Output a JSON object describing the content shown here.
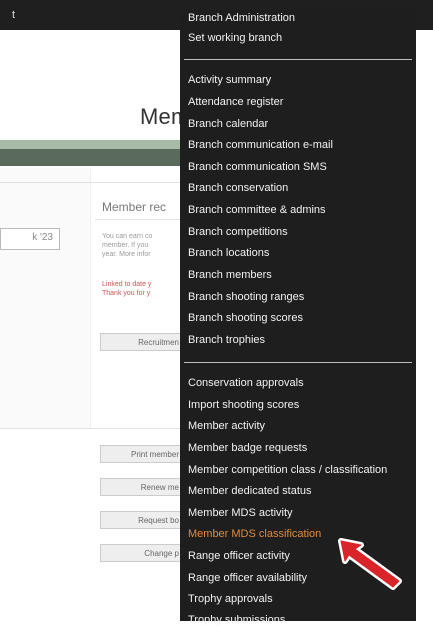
{
  "page": {
    "title": "Mem",
    "topbar_text": "t"
  },
  "left": {
    "date_value": "k '23"
  },
  "main": {
    "section_title": "Member rec",
    "paragraph": [
      "You can earn co",
      "member. If you",
      "year. More infor"
    ],
    "notice": [
      "Linked to date y",
      "Thank you for y"
    ],
    "buttons": [
      "Recruitmen",
      "Print member",
      "Renew me",
      "Request bo",
      "Change p"
    ]
  },
  "menu": {
    "group1": [
      "Branch Administration",
      "Set working branch"
    ],
    "group2": [
      "Activity summary",
      "Attendance register",
      "Branch calendar",
      "Branch communication e-mail",
      "Branch communication SMS",
      "Branch conservation",
      "Branch committee & admins",
      "Branch competitions",
      "Branch locations",
      "Branch members",
      "Branch shooting ranges",
      "Branch shooting scores",
      "Branch trophies"
    ],
    "group3": [
      "Conservation approvals",
      "Import shooting scores",
      "Member activity",
      "Member badge requests",
      "Member competition class / classification",
      "Member dedicated status",
      "Member MDS activity",
      "Member MDS classification",
      "Range officer activity",
      "Range officer availability",
      "Trophy approvals",
      "Trophy submissions"
    ],
    "active_item": "Member MDS classification",
    "colors": {
      "background": "#1e1e1e",
      "text": "#f2f2f2",
      "active": "#e08a3a",
      "arrow": "#d9242a"
    }
  }
}
